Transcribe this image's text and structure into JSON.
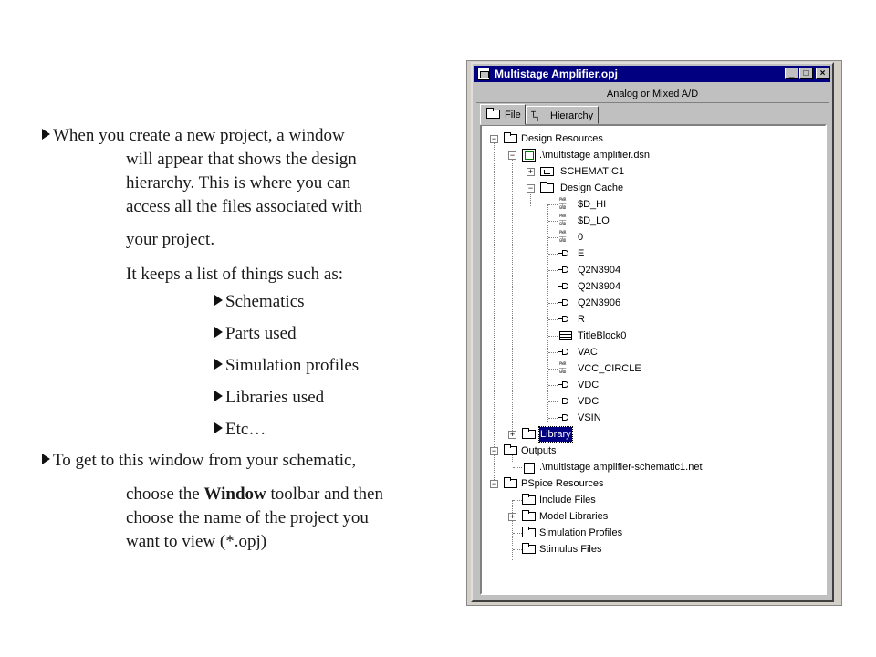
{
  "slide": {
    "bullet1_line1": "When you create a new project, a window",
    "bullet1_line2": "will appear that shows the design",
    "bullet1_line3": "hierarchy.  This is where you can",
    "bullet1_line4": "access all the files associated with",
    "bullet1_line5": "your project.",
    "keeps_list": "It keeps a list of  things such as:",
    "sub_items": [
      "Schematics",
      "Parts used",
      "Simulation profiles",
      "Libraries used",
      "Etc…"
    ],
    "bullet2_line1": "To get to this window from your schematic,",
    "bullet2_line2_pre": "choose the ",
    "bullet2_line2_bold": "Window",
    "bullet2_line2_post": " toolbar and then",
    "bullet2_line3": "choose the name of  the project you",
    "bullet2_line4": "want to view (*.opj)"
  },
  "window": {
    "title": "Multistage Amplifier.opj",
    "subtitle": "Analog or Mixed A/D",
    "minimize": "_",
    "maximize": "□",
    "close": "×",
    "tabs": [
      {
        "label": "File",
        "icon": "folder-icon"
      },
      {
        "label": "Hierarchy",
        "icon": "hierarchy-icon"
      }
    ]
  },
  "tree": {
    "design_resources": "Design Resources",
    "dsn_file": ".\\multistage amplifier.dsn",
    "schematic1": "SCHEMATIC1",
    "design_cache": "Design Cache",
    "cache_items": [
      {
        "label": "$D_HI",
        "icon": "power-ground-icon"
      },
      {
        "label": "$D_LO",
        "icon": "power-ground-icon"
      },
      {
        "label": "0",
        "icon": "power-ground-icon"
      },
      {
        "label": "E",
        "icon": "part-icon"
      },
      {
        "label": "Q2N3904",
        "icon": "part-icon"
      },
      {
        "label": "Q2N3904",
        "icon": "part-icon"
      },
      {
        "label": "Q2N3906",
        "icon": "part-icon"
      },
      {
        "label": "R",
        "icon": "part-icon"
      },
      {
        "label": "TitleBlock0",
        "icon": "title-block-icon"
      },
      {
        "label": "VAC",
        "icon": "part-icon"
      },
      {
        "label": "VCC_CIRCLE",
        "icon": "power-ground-icon"
      },
      {
        "label": "VDC",
        "icon": "part-icon"
      },
      {
        "label": "VDC",
        "icon": "part-icon"
      },
      {
        "label": "VSIN",
        "icon": "part-icon"
      }
    ],
    "library": "Library",
    "outputs": "Outputs",
    "net_file": ".\\multistage amplifier-schematic1.net",
    "pspice_resources": "PSpice Resources",
    "pspice_items": [
      "Include Files",
      "Model Libraries",
      "Simulation Profiles",
      "Stimulus Files"
    ],
    "pwr_text": "PWR"
  }
}
